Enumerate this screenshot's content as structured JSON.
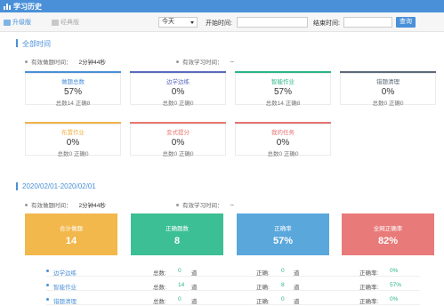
{
  "app": {
    "title": "学习历史"
  },
  "toolbar": {
    "version_new": "升级版",
    "version_old": "经典版",
    "range_select": "今天",
    "start_label": "开始时间:",
    "end_label": "结束时间:",
    "query_label": "查询"
  },
  "section_all": {
    "title": "全部时间",
    "meta_label_1": "有效做题时间：",
    "meta_value_1": "2分钟44秒",
    "meta_label_2": "有效学习时间：",
    "meta_value_2": "--",
    "cards": [
      {
        "title": "做题总数",
        "value": "57%",
        "sub": "总数14 正确8",
        "color": "#4a90d9"
      },
      {
        "title": "边学边练",
        "value": "0%",
        "sub": "总数0 正确0",
        "color": "#5b6bc0"
      },
      {
        "title": "智能作业",
        "value": "57%",
        "sub": "总数14 正确8",
        "color": "#2bb58a"
      },
      {
        "title": "错题清理",
        "value": "0%",
        "sub": "总数0 正确0",
        "color": "#5c6b7a"
      },
      {
        "title": "布置作业",
        "value": "0%",
        "sub": "总数0 正确0",
        "color": "#f0b24a"
      },
      {
        "title": "变式提分",
        "value": "0%",
        "sub": "总数0 正确0",
        "color": "#e8786f"
      },
      {
        "title": "我的任务",
        "value": "0%",
        "sub": "总数0 正确0",
        "color": "#e57373"
      }
    ]
  },
  "section_range": {
    "title": "2020/02/01-2020/02/01",
    "meta_label_1": "有效做题时间：",
    "meta_value_1": "2分钟44秒",
    "meta_label_2": "有效学习时间：",
    "meta_value_2": "--",
    "bigcards": [
      {
        "label": "合计做题",
        "value": "14",
        "color": "#f2b84b"
      },
      {
        "label": "正确题数",
        "value": "8",
        "color": "#3cbf95"
      },
      {
        "label": "正确率",
        "value": "57%",
        "color": "#5aa7dc"
      },
      {
        "label": "全网正确率",
        "value": "82%",
        "color": "#e97a7a"
      }
    ],
    "rows": [
      {
        "name": "边学边练",
        "total_label": "总数:",
        "total": "0",
        "unit": "道",
        "correct_label": "正确:",
        "correct": "0",
        "unit2": "道",
        "rate_label": "正确率:",
        "rate": "0%"
      },
      {
        "name": "智能作业",
        "total_label": "总数:",
        "total": "14",
        "unit": "道",
        "correct_label": "正确:",
        "correct": "8",
        "unit2": "道",
        "rate_label": "正确率:",
        "rate": "57%"
      },
      {
        "name": "错题清理",
        "total_label": "总数:",
        "total": "0",
        "unit": "道",
        "correct_label": "正确:",
        "correct": "0",
        "unit2": "道",
        "rate_label": "正确率:",
        "rate": "0%"
      }
    ]
  }
}
